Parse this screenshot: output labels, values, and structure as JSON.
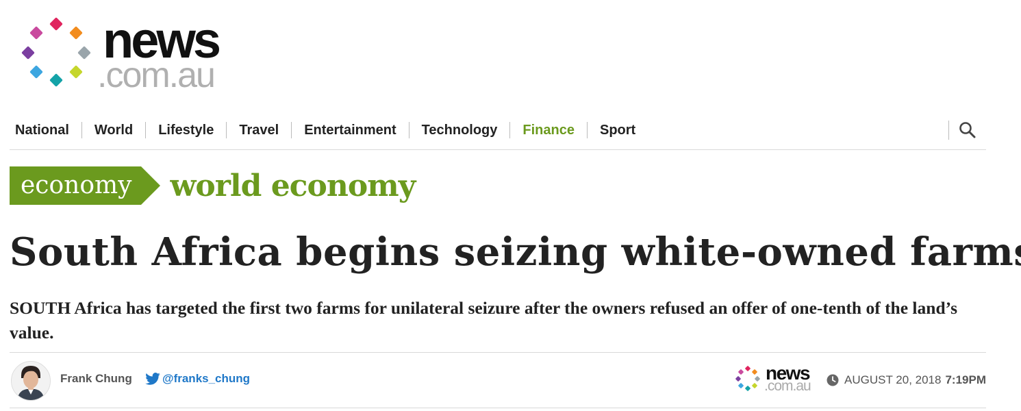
{
  "logo": {
    "brand": "news",
    "domain": ".com.au"
  },
  "nav": {
    "items": [
      {
        "label": "National"
      },
      {
        "label": "World"
      },
      {
        "label": "Lifestyle"
      },
      {
        "label": "Travel"
      },
      {
        "label": "Entertainment"
      },
      {
        "label": "Technology"
      },
      {
        "label": "Finance"
      },
      {
        "label": "Sport"
      }
    ],
    "active": "Finance",
    "search_icon": "search-icon"
  },
  "section": {
    "tag": "economy",
    "subsection": "world economy"
  },
  "article": {
    "headline": "South Africa begins seizing white-owned farms",
    "standfirst": "SOUTH Africa has targeted the first two farms for unilateral seizure after the owners refused an offer of one-tenth of the land’s value."
  },
  "byline": {
    "author": "Frank Chung",
    "twitter": "@franks_chung",
    "source_brand": "news",
    "source_domain": ".com.au",
    "date": "AUGUST 20, 2018",
    "time": "7:19PM"
  },
  "colors": {
    "accent": "#6b9a1e",
    "twitter": "#1f78c8",
    "text": "#222222",
    "logo_dots": [
      "#e0245e",
      "#f28c1e",
      "#9aa5ab",
      "#c5d62c",
      "#14a3a8",
      "#3da6e0",
      "#7b3fa0",
      "#c94a9e"
    ]
  }
}
